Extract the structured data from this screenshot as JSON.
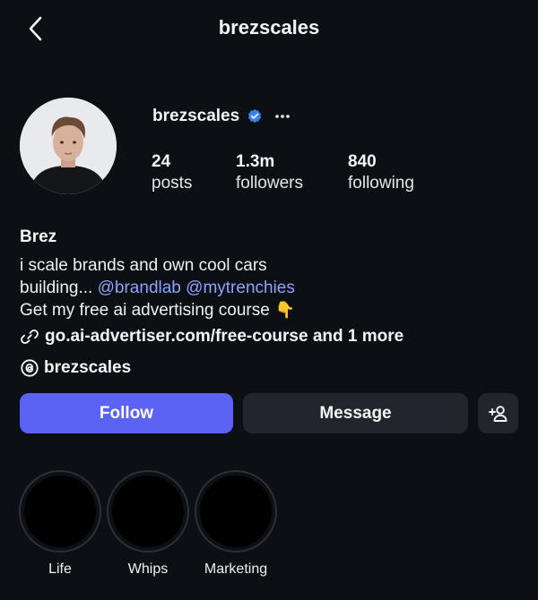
{
  "header": {
    "title": "brezscales",
    "back_icon": "chevron-left-icon"
  },
  "profile": {
    "username": "brezscales",
    "verified": true,
    "verified_color": "#3b82f6",
    "stats": [
      {
        "value": "24",
        "label": "posts"
      },
      {
        "value": "1.3m",
        "label": "followers"
      },
      {
        "value": "840",
        "label": "following"
      }
    ]
  },
  "bio": {
    "name": "Brez",
    "line1": "i scale brands and own cool cars",
    "line2_prefix": "building...",
    "mentions": [
      "@brandlab",
      "@mytrenchies"
    ],
    "line3": "Get my free ai advertising course",
    "line3_emoji": "👇",
    "link_text": "go.ai-advertiser.com/free-course and 1 more",
    "threads_handle": "brezscales"
  },
  "actions": {
    "follow_label": "Follow",
    "message_label": "Message",
    "follow_color": "#5b63f5"
  },
  "highlights": [
    {
      "label": "Life"
    },
    {
      "label": "Whips"
    },
    {
      "label": "Marketing"
    }
  ]
}
